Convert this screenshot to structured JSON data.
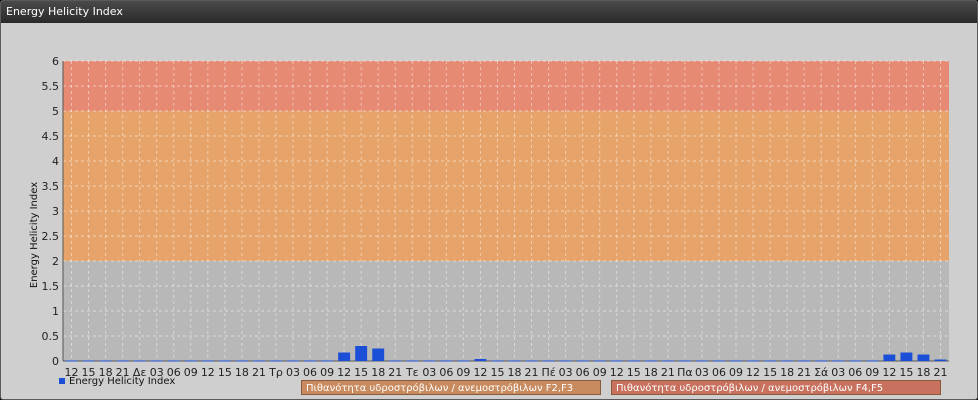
{
  "window": {
    "title": "Energy Helicity Index"
  },
  "colors": {
    "bar": "#1b4fd8",
    "band_low": "#b8b8b8",
    "band_mid": "#e7a46a",
    "band_high": "#e78a74",
    "legend_f2f3": "#c88a5f",
    "legend_f4f5": "#c7715e"
  },
  "legend": {
    "series": "Energy Helicity Index",
    "band_f2f3": "Πιθανότητα υδροστρόβιλων / ανεμοστρόβιλων F2,F3",
    "band_f4f5": "Πιθανότητα υδροστρόβιλων / ανεμοστρόβιλων F4,F5"
  },
  "chart_data": {
    "type": "bar",
    "title": "Energy Helicity Index",
    "ylabel": "Energy Helicity Index",
    "ylim": [
      0,
      6
    ],
    "yticks": [
      "0",
      "0.5",
      "1",
      "1.5",
      "2",
      "2.5",
      "3",
      "3.5",
      "4",
      "4.5",
      "5",
      "5.5",
      "6"
    ],
    "grid": true,
    "bands": [
      {
        "from": 0,
        "to": 2,
        "name": "low"
      },
      {
        "from": 2,
        "to": 5,
        "name": "F2,F3"
      },
      {
        "from": 5,
        "to": 6,
        "name": "F4,F5"
      }
    ],
    "categories": [
      "12",
      "15",
      "18",
      "21",
      "Δε",
      "03",
      "06",
      "09",
      "12",
      "15",
      "18",
      "21",
      "Τρ",
      "03",
      "06",
      "09",
      "12",
      "15",
      "18",
      "21",
      "Τε",
      "03",
      "06",
      "09",
      "12",
      "15",
      "18",
      "21",
      "Πέ",
      "03",
      "06",
      "09",
      "12",
      "15",
      "18",
      "21",
      "Πα",
      "03",
      "06",
      "09",
      "12",
      "15",
      "18",
      "21",
      "Σά",
      "03",
      "06",
      "09",
      "12",
      "15",
      "18",
      "21"
    ],
    "series": [
      {
        "name": "Energy Helicity Index",
        "values": [
          0.01,
          0.01,
          0.01,
          0.01,
          0.01,
          0.01,
          0.01,
          0.01,
          0.01,
          0.01,
          0.01,
          0.01,
          0.01,
          0.01,
          0.01,
          0.01,
          0.17,
          0.3,
          0.25,
          0.01,
          0.01,
          0.01,
          0.01,
          0.01,
          0.04,
          0.01,
          0.01,
          0.01,
          0.01,
          0.01,
          0.01,
          0.01,
          0.01,
          0.01,
          0.01,
          0.01,
          0.01,
          0.01,
          0.01,
          0.01,
          0.01,
          0.01,
          0.01,
          0.01,
          0.01,
          0.01,
          0.01,
          0.01,
          0.13,
          0.17,
          0.13,
          0.03
        ]
      }
    ]
  }
}
